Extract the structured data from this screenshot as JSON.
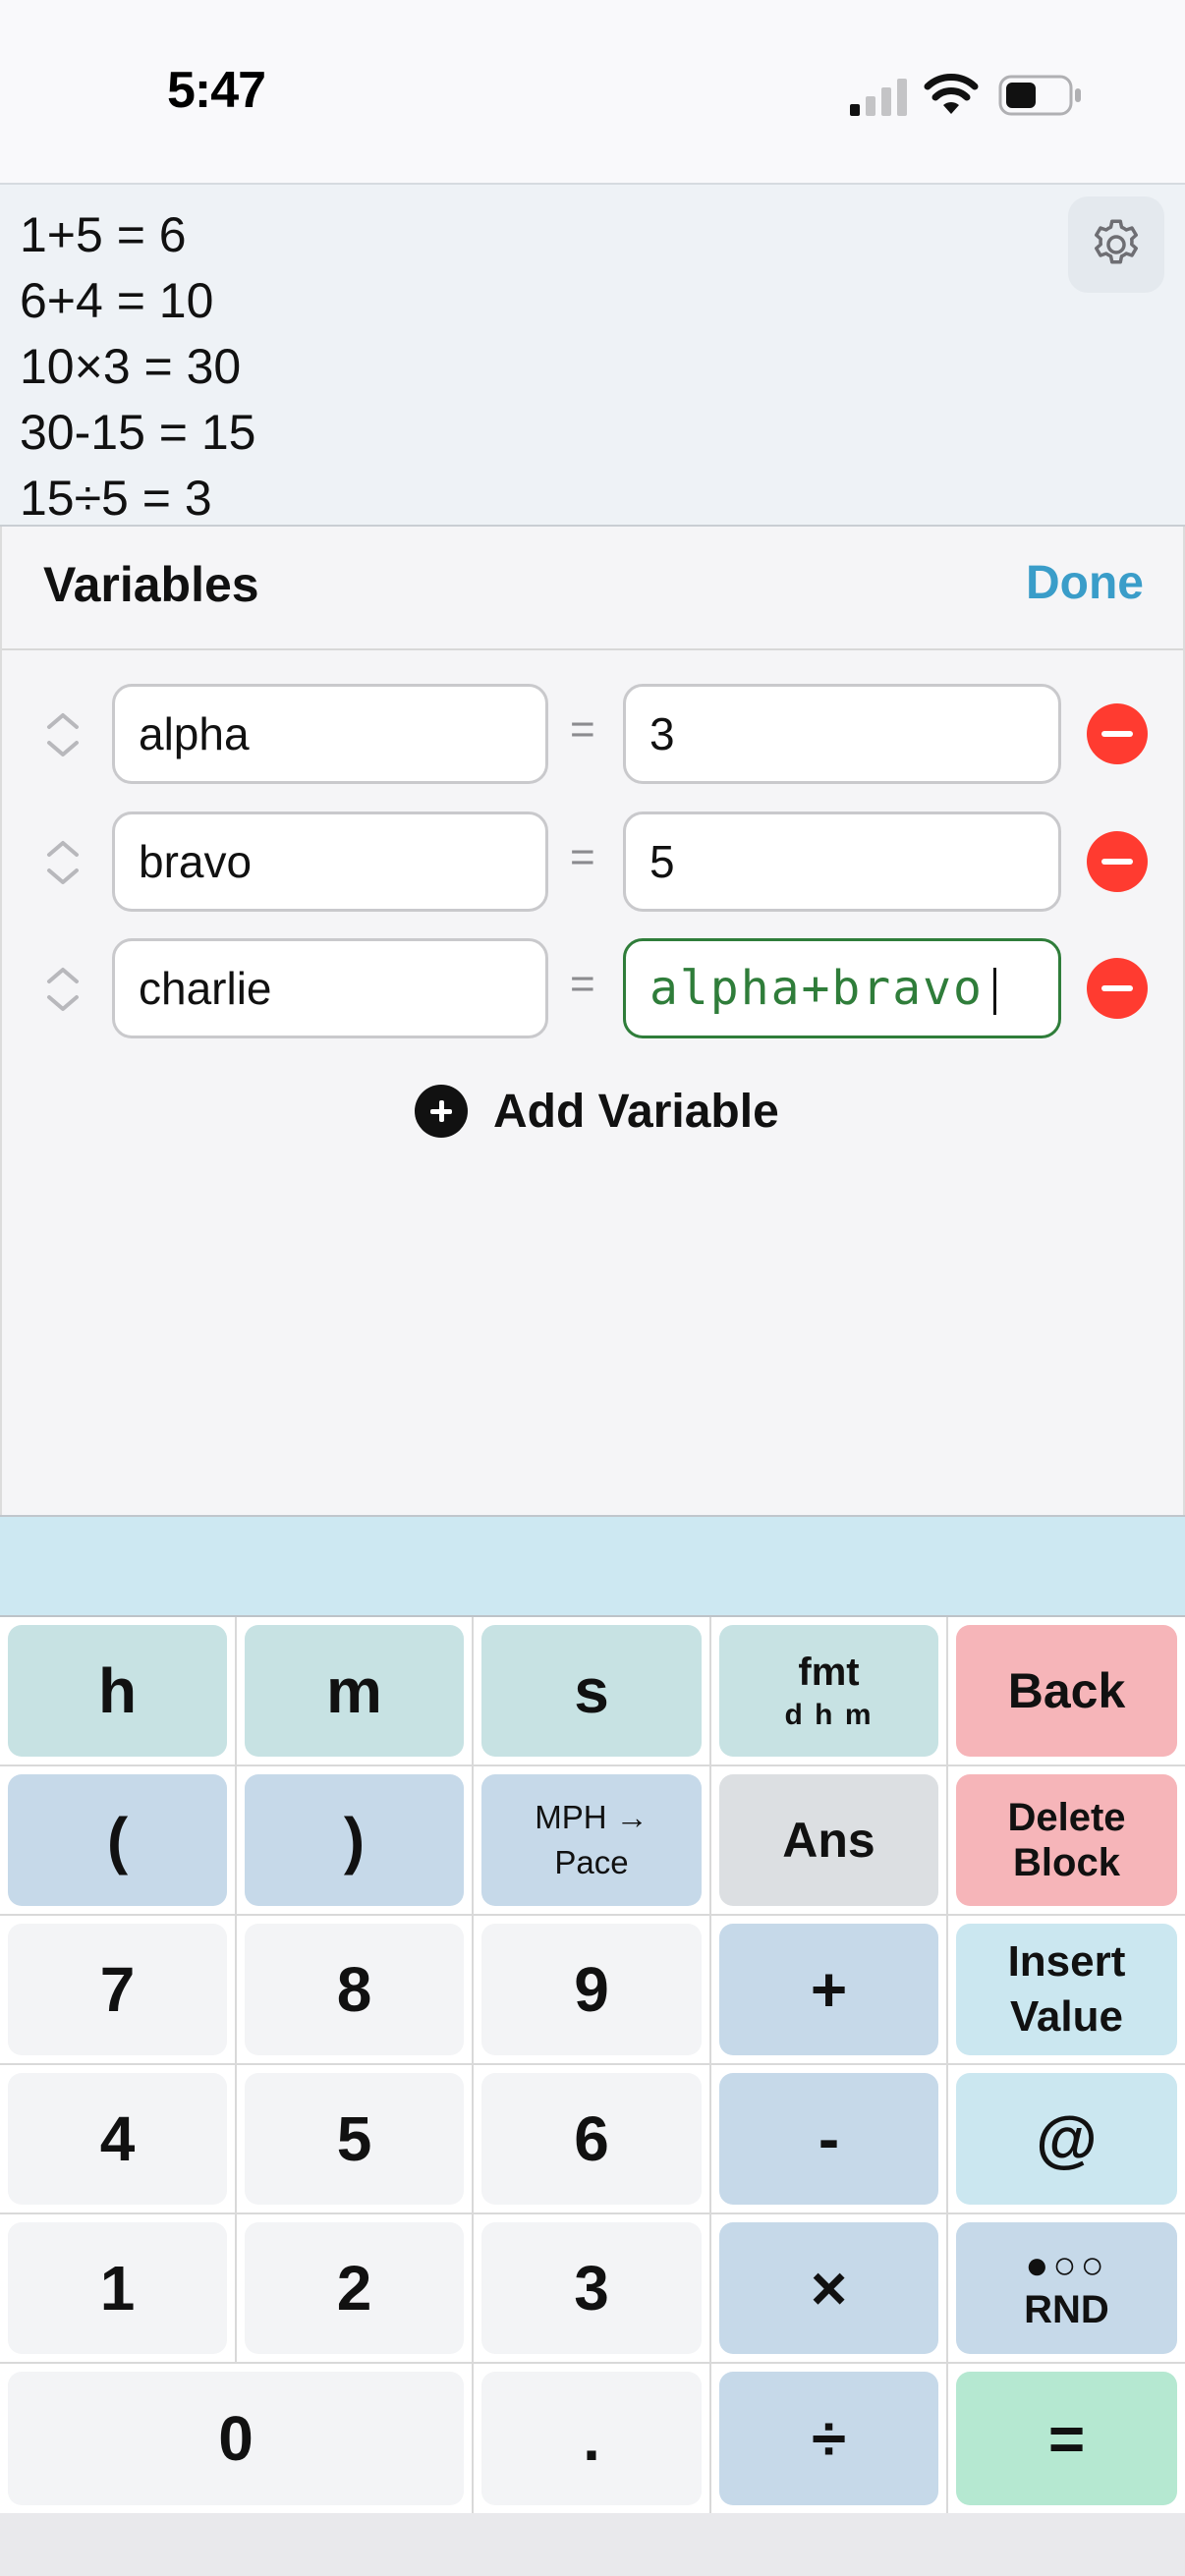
{
  "status_bar": {
    "time": "5:47"
  },
  "history": {
    "lines": [
      "1+5 = 6",
      "6+4 = 10",
      "10×3 = 30",
      "30-15 = 15",
      "15÷5 = 3"
    ]
  },
  "variables": {
    "title": "Variables",
    "done_label": "Done",
    "equals": "=",
    "rows": [
      {
        "name": "alpha",
        "value": "3"
      },
      {
        "name": "bravo",
        "value": "5"
      },
      {
        "name": "charlie",
        "value": "alpha+bravo"
      }
    ],
    "add_label": "Add Variable"
  },
  "keypad": {
    "h": "h",
    "m": "m",
    "s": "s",
    "fmt": "fmt",
    "fmt_sub": "d h m",
    "back": "Back",
    "open_paren": "(",
    "close_paren": ")",
    "mph_line1": "MPH →",
    "mph_line2": "Pace",
    "ans": "Ans",
    "delete_line1": "Delete",
    "delete_line2": "Block",
    "k7": "7",
    "k8": "8",
    "k9": "9",
    "plus": "+",
    "insert_line1": "Insert",
    "insert_line2": "Value",
    "k4": "4",
    "k5": "5",
    "k6": "6",
    "minus": "-",
    "at": "@",
    "k1": "1",
    "k2": "2",
    "k3": "3",
    "times": "×",
    "rnd_dots": "●○○",
    "rnd": "RND",
    "k0": "0",
    "dot": ".",
    "divide": "÷",
    "equals": "="
  },
  "colors": {
    "accent": "#3a9dc9",
    "remove": "#ff3b30",
    "active_field": "#2f7d3a"
  }
}
